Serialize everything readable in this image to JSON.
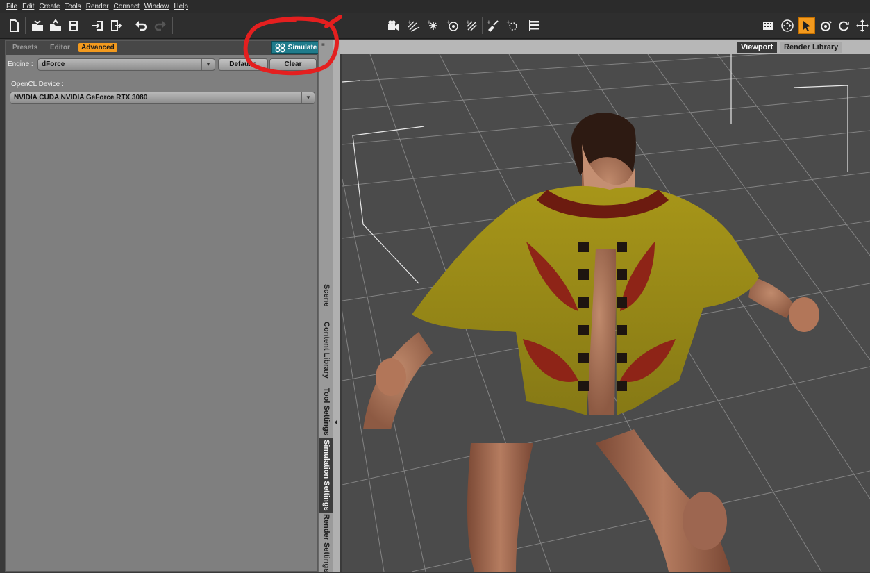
{
  "menu": {
    "items": [
      "File",
      "Edit",
      "Create",
      "Tools",
      "Render",
      "Connect",
      "Window",
      "Help"
    ]
  },
  "toolbar": {
    "file_icons": [
      "new-file-icon",
      "open-icon",
      "merge-icon",
      "save-icon",
      "import-icon",
      "export-icon",
      "undo-icon",
      "redo-icon"
    ],
    "scene_icons": [
      "camera-icon",
      "spotlight-icon",
      "point-light-icon",
      "distant-light-icon",
      "linear-light-icon",
      "ambient-light-icon",
      "sky-light-icon",
      "align-icon"
    ],
    "tool_icons": [
      "grid-icon",
      "universal-tool-icon",
      "node-selection-icon",
      "rotate-tool-icon",
      "translate-tool-icon",
      "move-tool-icon"
    ]
  },
  "simulation_panel": {
    "tabs": {
      "presets": "Presets",
      "editor": "Editor",
      "advanced": "Advanced"
    },
    "simulate_label": "Simulate",
    "engine_label": "Engine :",
    "engine_value": "dForce",
    "defaults_label": "Defaults",
    "clear_label": "Clear",
    "opencl_label": "OpenCL Device :",
    "opencl_value": "NVIDIA CUDA NVIDIA GeForce RTX 3080"
  },
  "side_tabs": {
    "scene": "Scene",
    "content_library": "Content Library",
    "tool_settings": "Tool Settings",
    "simulation_settings": "Simulation Settings",
    "render_settings": "Render Settings"
  },
  "viewport": {
    "tabs": {
      "viewport": "Viewport",
      "render_library": "Render Library"
    }
  },
  "colors": {
    "accent_orange": "#f39a1e",
    "simulate_teal": "#1f7c8c",
    "annotation_red": "#e41f1f",
    "cloth_yellow": "#9c8d1b",
    "cloth_red": "#8e2417"
  }
}
